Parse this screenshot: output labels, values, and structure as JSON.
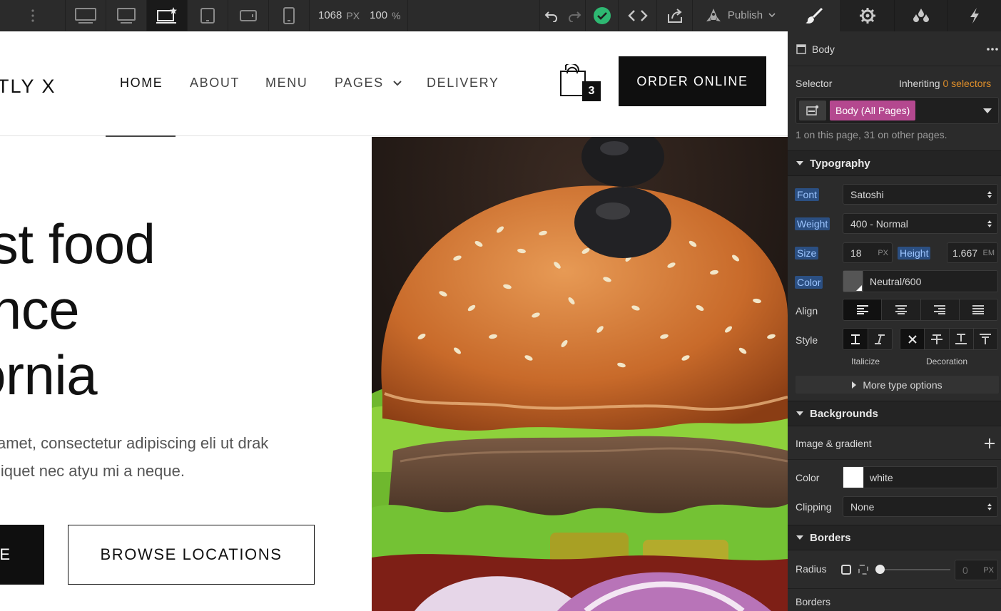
{
  "toolbar": {
    "width_value": "1068",
    "width_unit": "PX",
    "zoom_value": "100",
    "zoom_unit": "%",
    "publish_label": "Publish"
  },
  "site": {
    "logo": "TLY X",
    "nav": [
      "HOME",
      "ABOUT",
      "MENU",
      "PAGES",
      "DELIVERY"
    ],
    "cart_count": "3",
    "order_button": "ORDER ONLINE",
    "hero_lines": [
      "est food",
      "ence",
      "fornia"
    ],
    "hero_text_lines": [
      "amet, consectetur adipiscing eli ut drak",
      "liquet nec atyu mi a neque."
    ],
    "primary_button": "E",
    "secondary_button": "BROWSE LOCATIONS"
  },
  "panel": {
    "element_name": "Body",
    "selector_label": "Selector",
    "inheriting_prefix": "Inheriting",
    "inheriting_count": "0 selectors",
    "selector_chip": "Body (All Pages)",
    "usage_note": "1 on this page, 31 on other pages.",
    "typography": {
      "title": "Typography",
      "font_label": "Font",
      "font_value": "Satoshi",
      "weight_label": "Weight",
      "weight_value": "400 - Normal",
      "size_label": "Size",
      "size_value": "18",
      "size_unit": "PX",
      "height_label": "Height",
      "height_value": "1.667",
      "height_unit": "EM",
      "color_label": "Color",
      "color_value": "Neutral/600",
      "align_label": "Align",
      "style_label": "Style",
      "italicize_caption": "Italicize",
      "decoration_caption": "Decoration",
      "more_options": "More type options"
    },
    "backgrounds": {
      "title": "Backgrounds",
      "image_gradient_label": "Image & gradient",
      "color_label": "Color",
      "color_value": "white",
      "clipping_label": "Clipping",
      "clipping_value": "None"
    },
    "borders": {
      "title": "Borders",
      "radius_label": "Radius",
      "radius_value": "0",
      "radius_unit": "PX",
      "borders_label": "Borders"
    }
  },
  "colors": {
    "accent_green": "#2eb872",
    "selector_chip": "#b4488f",
    "inheriting_orange": "#e08f2a",
    "label_highlight": "#2b4f82"
  }
}
